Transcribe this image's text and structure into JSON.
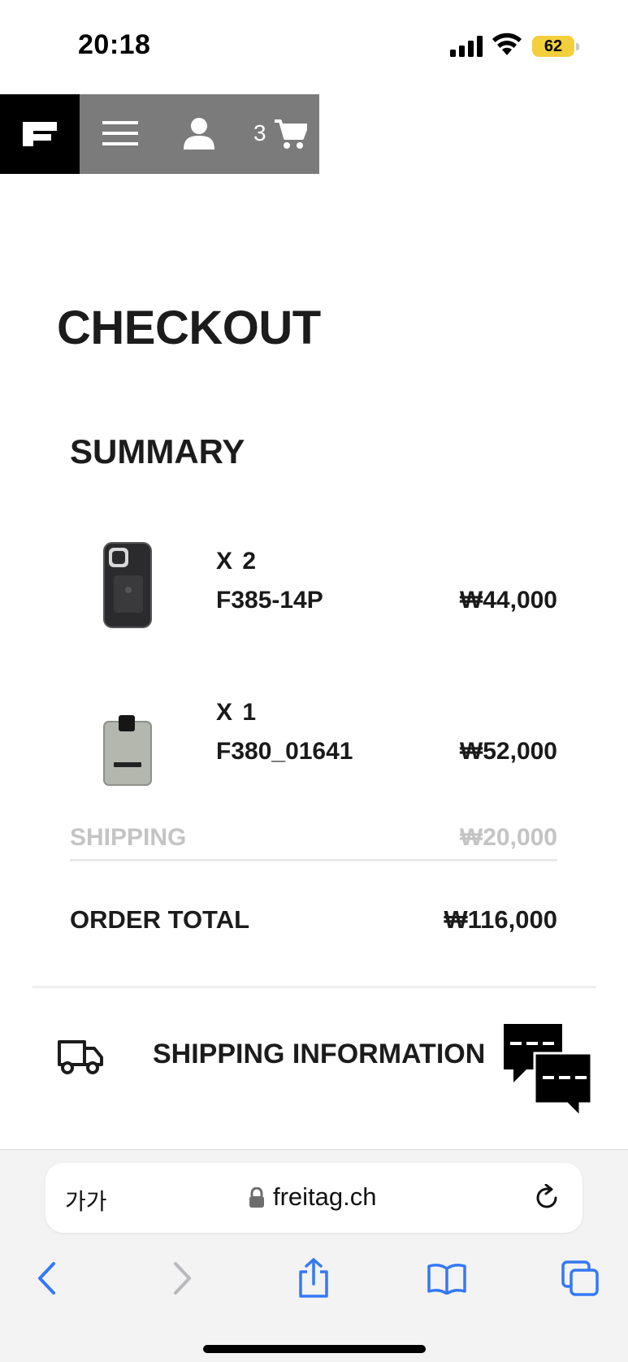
{
  "status_bar": {
    "time": "20:18",
    "battery": "62",
    "icons": [
      "signal-icon",
      "wifi-icon",
      "battery-icon"
    ]
  },
  "site_nav": {
    "logo": "freitag-logo",
    "cart_count": "3",
    "icons": [
      "menu-icon",
      "user-icon",
      "cart-icon"
    ]
  },
  "checkout": {
    "title": "CHECKOUT",
    "summary_title": "SUMMARY",
    "items": [
      {
        "qty": "X  2",
        "name": "F385-14P",
        "price": "₩44,000"
      },
      {
        "qty": "X  1",
        "name": "F380_01641",
        "price": "₩52,000"
      }
    ],
    "shipping": {
      "label": "SHIPPING",
      "value": "₩20,000"
    },
    "total": {
      "label": "ORDER TOTAL",
      "value": "₩116,000"
    },
    "shipping_info": {
      "label": "SHIPPING INFORMATION"
    }
  },
  "browser": {
    "text_size_label": "가가",
    "url": "freitag.ch",
    "toolbar": [
      "back-icon",
      "forward-icon",
      "share-icon",
      "bookmarks-icon",
      "tabs-icon"
    ]
  },
  "colors": {
    "nav_gray": "#7b7b7b",
    "battery": "#f4cf3c",
    "ios_blue": "#3478f6",
    "muted_text": "#c4c4c4"
  }
}
